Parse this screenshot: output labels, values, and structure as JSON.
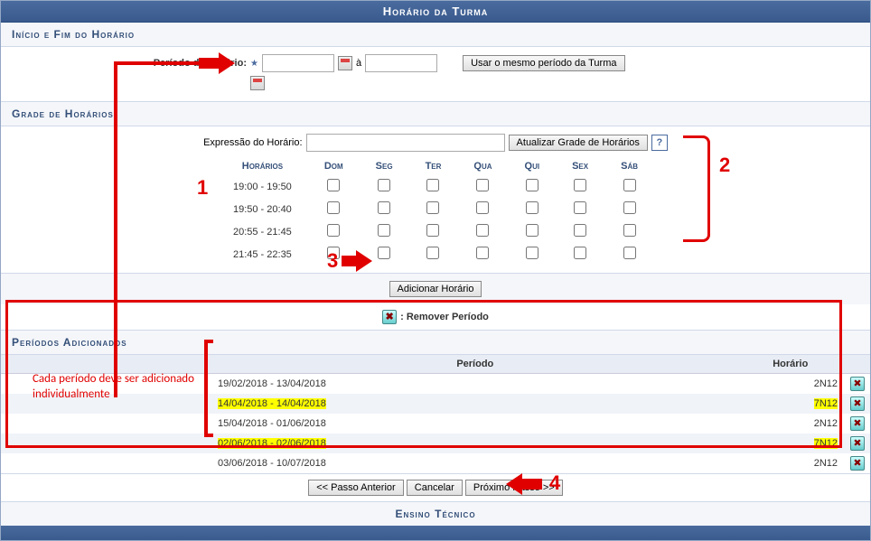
{
  "title": "Horário da Turma",
  "sections": {
    "inicio": "Início e Fim do Horário",
    "grade": "Grade de Horários",
    "periodos": "Períodos Adicionados"
  },
  "periodoField": {
    "label": "Período do Horário:",
    "sep": "à",
    "start": "",
    "end": "",
    "sameButton": "Usar o mesmo período da Turma"
  },
  "exprField": {
    "label": "Expressão do Horário:",
    "value": "",
    "updateButton": "Atualizar Grade de Horários"
  },
  "gridHeader": {
    "time": "Horários",
    "days": [
      "Dom",
      "Seg",
      "Ter",
      "Qua",
      "Qui",
      "Sex",
      "Sáb"
    ]
  },
  "timeSlots": [
    "19:00 - 19:50",
    "19:50 - 20:40",
    "20:55 - 21:45",
    "21:45 - 22:35"
  ],
  "addButton": "Adicionar Horário",
  "removeLegend": ": Remover Período",
  "periodsTable": {
    "cols": {
      "periodo": "Período",
      "horario": "Horário"
    },
    "rows": [
      {
        "periodo": "19/02/2018 - 13/04/2018",
        "horario": "2N12",
        "hl": false
      },
      {
        "periodo": "14/04/2018 - 14/04/2018",
        "horario": "7N12",
        "hl": true
      },
      {
        "periodo": "15/04/2018 - 01/06/2018",
        "horario": "2N12",
        "hl": false
      },
      {
        "periodo": "02/06/2018 - 02/06/2018",
        "horario": "7N12",
        "hl": true
      },
      {
        "periodo": "03/06/2018 - 10/07/2018",
        "horario": "2N12",
        "hl": false
      }
    ]
  },
  "nav": {
    "prev": "<< Passo Anterior",
    "cancel": "Cancelar",
    "next": "Próximo Passo >>"
  },
  "footer": "Ensino Técnico",
  "annotations": {
    "n1": "1",
    "n2": "2",
    "n3": "3",
    "n4": "4",
    "note": "Cada período deve ser adicionado individualmente"
  }
}
